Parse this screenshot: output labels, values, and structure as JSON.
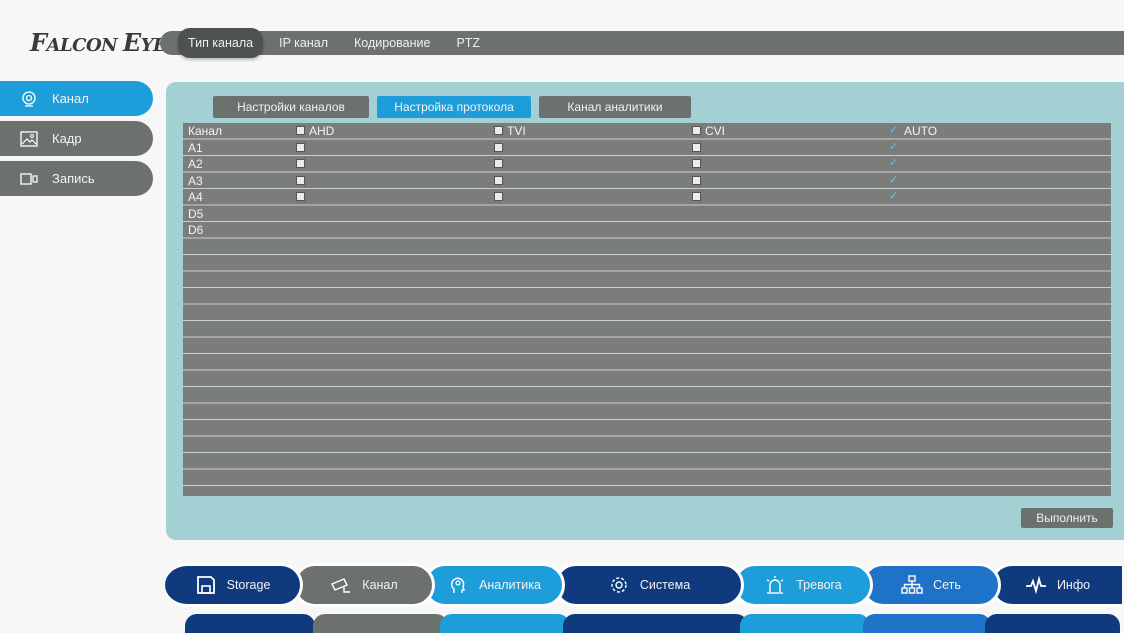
{
  "logo": {
    "text_first": "F",
    "text_mid": "ALCON ",
    "text_e": "E",
    "text_end": "YE"
  },
  "top_tabs": [
    "Тип канала",
    "IP канал",
    "Кодирование",
    "PTZ"
  ],
  "sidebar": [
    {
      "label": "Канал",
      "icon": "webcam-icon",
      "active": true
    },
    {
      "label": "Кадр",
      "icon": "image-icon",
      "active": false
    },
    {
      "label": "Запись",
      "icon": "record-icon",
      "active": false
    }
  ],
  "sub_tabs": [
    "Настройки каналов",
    "Настройка протокола",
    "Канал аналитики"
  ],
  "table": {
    "headers": [
      "Канал",
      "AHD",
      "TVI",
      "CVI",
      "AUTO"
    ],
    "header_checked": [
      false,
      false,
      false,
      true
    ],
    "rows": [
      {
        "channel": "A1",
        "checks": [
          false,
          false,
          false,
          true
        ]
      },
      {
        "channel": "A2",
        "checks": [
          false,
          false,
          false,
          true
        ]
      },
      {
        "channel": "A3",
        "checks": [
          false,
          false,
          false,
          true
        ]
      },
      {
        "channel": "A4",
        "checks": [
          false,
          false,
          false,
          true
        ]
      },
      {
        "channel": "D5",
        "checks": null
      },
      {
        "channel": "D6",
        "checks": null
      }
    ]
  },
  "execute_button": "Выполнить",
  "bottom_nav": [
    {
      "label": "Storage",
      "icon": "floppy-icon"
    },
    {
      "label": "Канал",
      "icon": "cctv-camera-icon"
    },
    {
      "label": "Аналитика",
      "icon": "analytics-head-icon"
    },
    {
      "label": "Система",
      "icon": "gear-icon"
    },
    {
      "label": "Тревога",
      "icon": "alarm-light-icon"
    },
    {
      "label": "Сеть",
      "icon": "network-icon"
    },
    {
      "label": "Инфо",
      "icon": "pulse-icon"
    }
  ],
  "colors": {
    "accent": "#1e9ddb",
    "dark_blue": "#0f3b7e",
    "gray": "#6d716e",
    "panel": "#a4cfd3"
  }
}
